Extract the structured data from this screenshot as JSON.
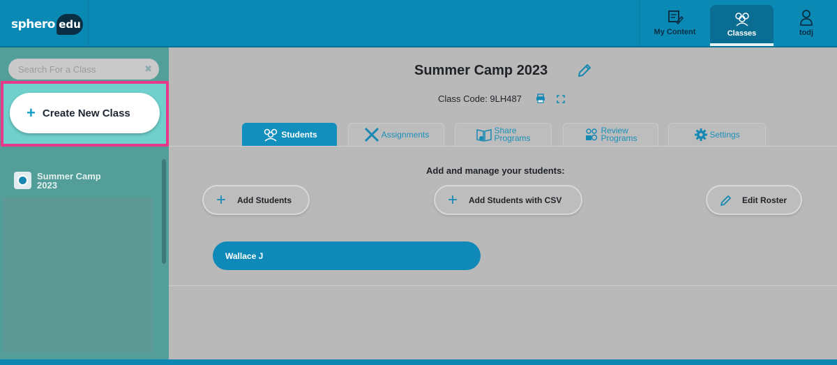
{
  "header": {
    "logo_text": "sphero",
    "logo_badge": "edu",
    "nav": {
      "my_content": "My Content",
      "classes": "Classes",
      "user": "todj"
    }
  },
  "sidebar": {
    "search_placeholder": "Search For a Class",
    "create_button": "Create New Class",
    "classes": [
      {
        "name_line1": "Summer Camp",
        "name_line2": "2023"
      }
    ]
  },
  "main": {
    "title": "Summer Camp 2023",
    "class_code": "Class Code: 9LH487",
    "tabs": {
      "students": "Students",
      "assignments": "Assignments",
      "share_line1": "Share",
      "share_line2": "Programs",
      "review_line1": "Review",
      "review_line2": "Programs",
      "settings": "Settings"
    },
    "panel": {
      "heading": "Add and manage your students:",
      "add_students": "Add Students",
      "add_csv": "Add Students with CSV",
      "edit_roster": "Edit Roster",
      "students": [
        "Wallace J"
      ]
    }
  },
  "colors": {
    "header": "#0b89b5",
    "sidebar": "#549e9a",
    "highlight_border": "#e8388a",
    "active_tab": "#128fbd"
  }
}
